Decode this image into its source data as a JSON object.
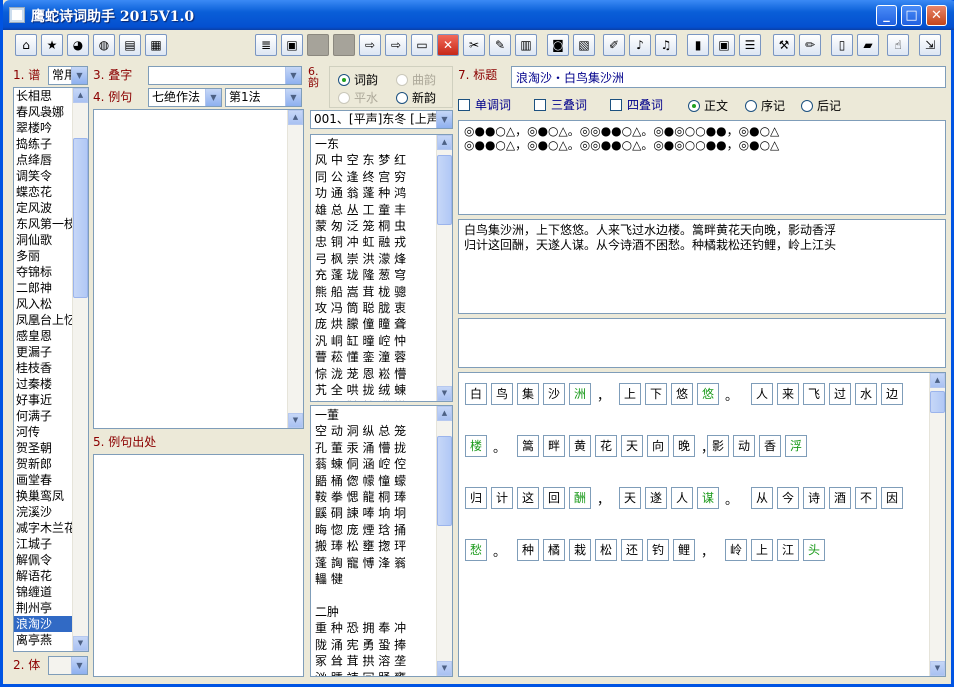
{
  "app": {
    "title": "鹰蛇诗词助手 2015V1.0"
  },
  "window_controls": {
    "min": "_",
    "max": "□",
    "close": "✕"
  },
  "toolbar": {
    "icons": [
      "home-icon",
      "folder-star-icon",
      "qq-icon",
      "globe-icon",
      "books-icon",
      "windows-icon",
      "document-icon",
      "save-icon",
      "blank-icon",
      "blank-icon",
      "arrow-right-icon",
      "arrow-right-active-icon",
      "open-folder-icon",
      "close-icon",
      "cut-icon",
      "paint-icon",
      "books2-icon",
      "camera-icon",
      "image-icon",
      "note-icon",
      "music-icon",
      "music2-icon",
      "bar-chart-icon",
      "pink-window-icon",
      "list-icon",
      "tools-icon",
      "draw-icon",
      "book-icon",
      "book2-icon",
      "hand-icon",
      "exit-icon"
    ]
  },
  "labels": {
    "pu": "1. 谱",
    "dieci": "3. 叠字",
    "liju": "4. 例句",
    "lijuchu": "5. 例句出处",
    "ti": "2. 体",
    "yun": "6. 韵",
    "biaoti": "7. 标题"
  },
  "combos": {
    "pu_value": "常用",
    "dieci_value": "",
    "liju_style": "七绝作法",
    "liju_method": "第1法",
    "rhyme_group": "001、[平声]东冬 [上声]"
  },
  "tunes": [
    "长相思",
    "春风袅娜",
    "翠楼吟",
    "捣练子",
    "点绛唇",
    "调笑令",
    "蝶恋花",
    "定风波",
    "东风第一枝",
    "洞仙歌",
    "多丽",
    "夺锦标",
    "二郎神",
    "风入松",
    "凤凰台上忆",
    "感皇恩",
    "更漏子",
    "桂枝香",
    "过秦楼",
    "好事近",
    "何满子",
    "河传",
    "贺圣朝",
    "贺新郎",
    "画堂春",
    "换巢鸾凤",
    "浣溪沙",
    "减字木兰花",
    "江城子",
    "解佩令",
    "解语花",
    "锦缠道",
    "荆州亭",
    "浪淘沙",
    "离亭燕"
  ],
  "selected_tune": "浪淘沙",
  "rhyme_radios": {
    "ciyun": "词韵",
    "quyun": "曲韵",
    "pingshui": "平水",
    "xinyun": "新韵"
  },
  "rhyme_top": "一东\n风 中 空 东 梦 红\n同 公 逢 终 宫 穷\n功 通 翁 蓬 种 鸿\n雄 总 丛 工 童 丰\n蒙 匆 泛 笼 桐 虫\n忠 铜 冲 虹 融 戎\n弓 枫 崇 洪 濛 烽\n充 蓬 珑 隆 葱 穹\n熊 船 嵩 茸 栊 骢\n攻 冯 筒 聪 胧 衷\n庞 烘 朦 僮 瞳 聋\n汎 峒 缸 曈 崆 忡\n瞢 菘 懂 銮 潼 蓉\n悰 泷 茏 恩 崧 懵\n艽 全 哄 拢 绒 蝀\n侗 峪 鞑 玆 瑽 媺\n龍 恫 幪 艨 蠓 瘕\n罿 鑫 逢 苘 洼 江",
  "rhyme_bottom": "一董\n空 动 洞 纵 总 笼\n孔 董 汞 涌 懵 拢\n蓊 蝀 侗 涵 崆 倥\n鼯 桶 偬 幪 憧 蠓\n鞍 拳 愢 龍 桐 琫\n鼷 硐 諫 唪 垧 坰\n晦 惚 庞 煙 琀 捅\n搬 琫 松 壅 揔 玶\n蓬 詾 寵 愽 浲 嵡\n轠 犍\n\n二肿\n重 种 恐 拥 奉 冲\n陇 涌 宪 勇 蛩 捧\n冢 耸 茸 拱 溶 垄\n汹 踵 竦 冗 踊 壅\n巩 肿 甬 崆 悚 栱\n倎 潼 蛹 翻 醧 勇",
  "title_value": "浪淘沙・白鸟集沙洲",
  "checks": {
    "tiaoci": "单调词",
    "sandie": "三叠词",
    "sidie": "四叠词"
  },
  "text_type": {
    "zhengwen": "正文",
    "xuji": "序记",
    "houji": "后记"
  },
  "pattern_lines": [
    "◎●●○△，◎●○△。◎◎●●○△。◎●◎○○●●，◎●○△",
    "◎●●○△，◎●○△。◎◎●●○△。◎●◎○○●●，◎●○△"
  ],
  "poem_lines": [
    "白鸟集沙洲，上下悠悠。人来飞过水边楼。篙畔黄花天向晚，影动香浮",
    "归计这回酬，天遂人谋。从今诗酒不困愁。种橘栽松还钓鲤，岭上江头"
  ],
  "grid_rows": [
    {
      "chars": [
        "白",
        "鸟",
        "集",
        "沙",
        "洲"
      ],
      "rhy": [
        4
      ],
      "p": "，"
    },
    {
      "chars": [
        "上",
        "下",
        "悠",
        "悠"
      ],
      "rhy": [
        3
      ],
      "p": "。"
    },
    {
      "chars": [
        "人",
        "来",
        "飞",
        "过",
        "水",
        "边"
      ],
      "rhy": []
    },
    {
      "chars": [
        "楼"
      ],
      "rhy": [
        0
      ],
      "p": "。"
    },
    {
      "chars": [
        "篙",
        "畔",
        "黄",
        "花",
        "天",
        "向",
        "晚"
      ],
      "rhy": [],
      "p": "，"
    },
    {
      "chars": [
        "影",
        "动",
        "香",
        "浮"
      ],
      "rhy": [
        3
      ]
    },
    {
      "chars": [
        "归",
        "计",
        "这",
        "回",
        "酬"
      ],
      "rhy": [
        4
      ],
      "p": "，"
    },
    {
      "chars": [
        "天",
        "遂",
        "人",
        "谋"
      ],
      "rhy": [
        3
      ],
      "p": "。"
    },
    {
      "chars": [
        "从",
        "今",
        "诗",
        "酒",
        "不",
        "因"
      ],
      "rhy": []
    },
    {
      "chars": [
        "愁"
      ],
      "rhy": [
        0
      ],
      "p": "。"
    },
    {
      "chars": [
        "种",
        "橘",
        "栽",
        "松",
        "还",
        "钓",
        "鲤"
      ],
      "rhy": [],
      "p": "，"
    },
    {
      "chars": [
        "岭",
        "上",
        "江",
        "头"
      ],
      "rhy": [
        3
      ]
    }
  ]
}
